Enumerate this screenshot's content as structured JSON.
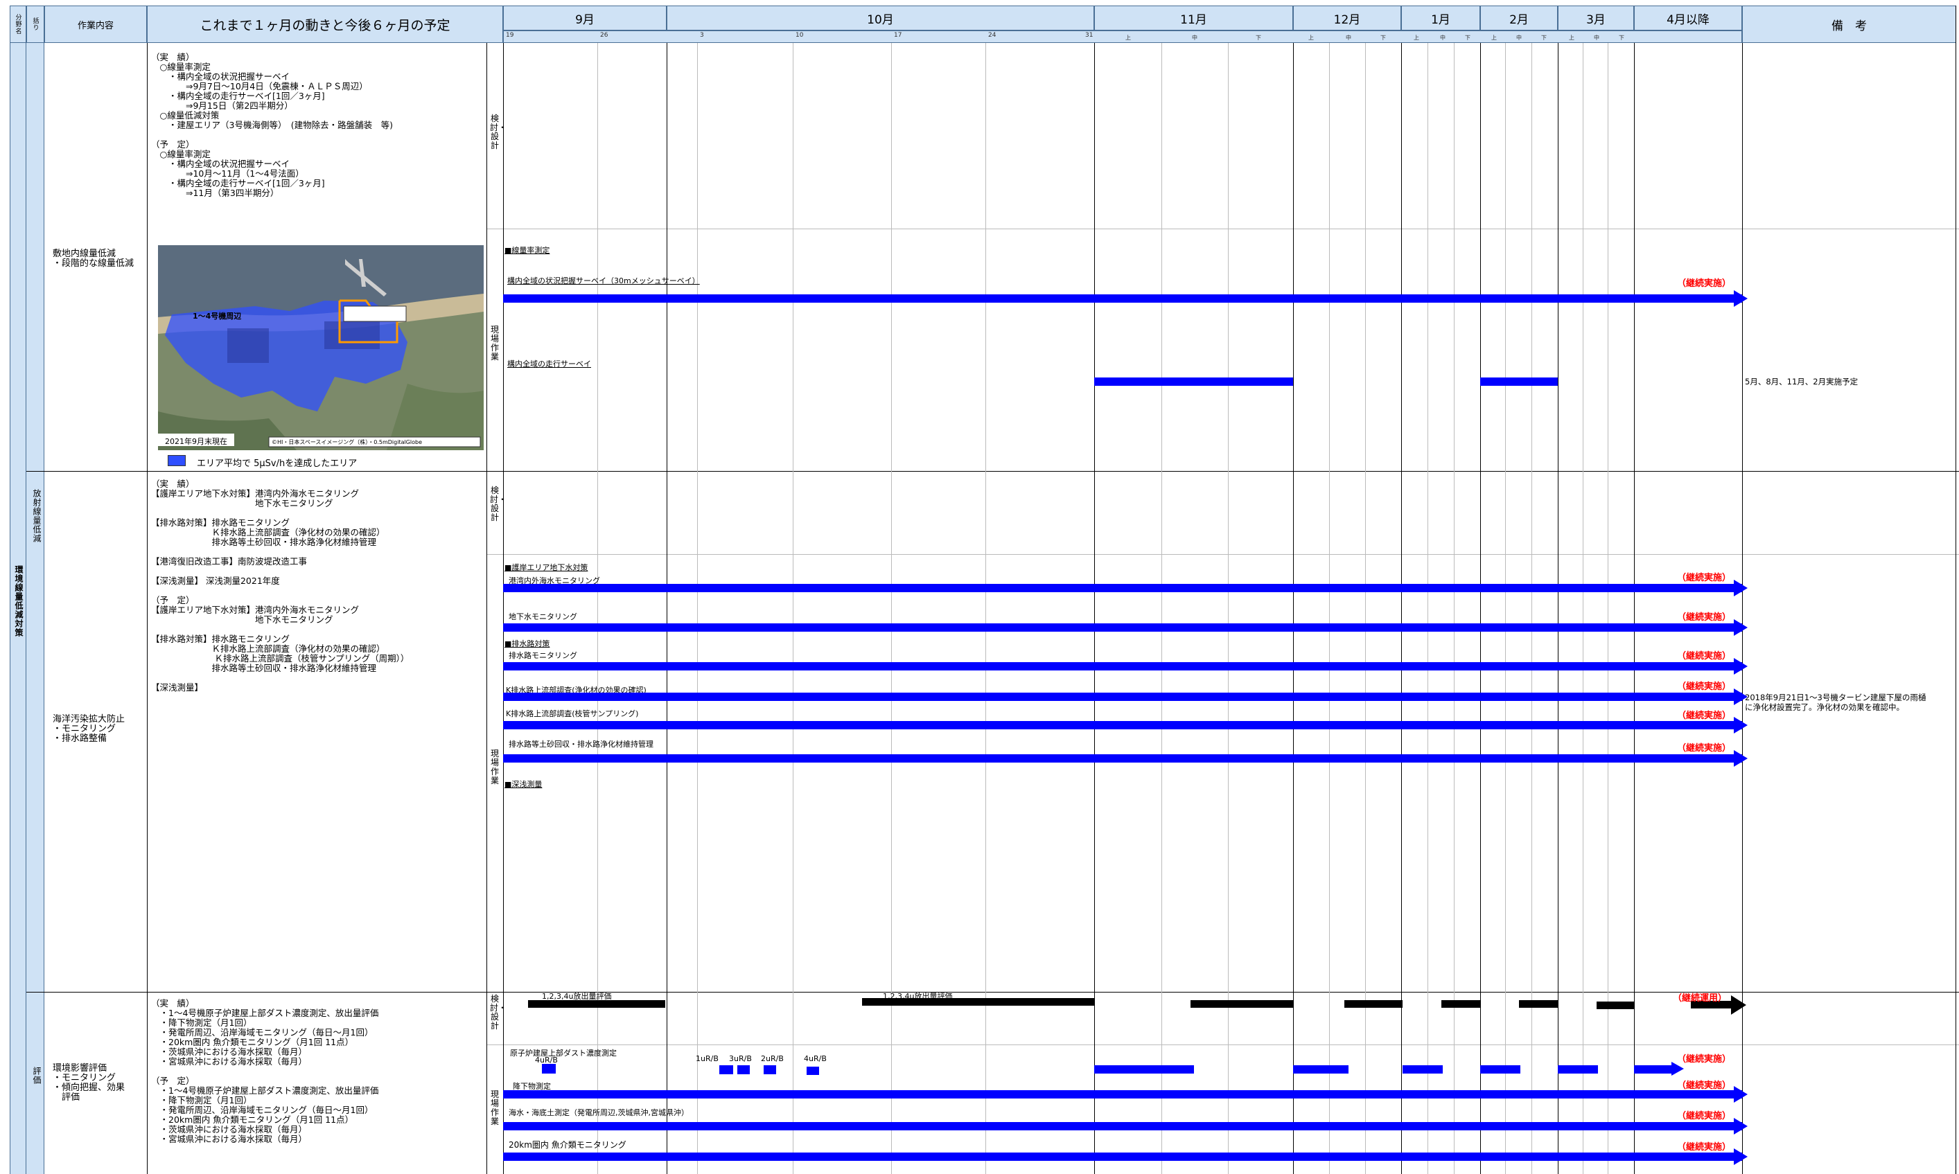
{
  "header": {
    "col1": "分野名",
    "col2": "括り",
    "col3": "作業内容",
    "col4": "これまで１ヶ月の動きと今後６ヶ月の予定",
    "months": [
      "9月",
      "10月",
      "11月",
      "12月",
      "1月",
      "2月",
      "3月",
      "4月以降"
    ],
    "remarks": "備　考",
    "days": [
      "19",
      "26",
      "3",
      "10",
      "17",
      "24",
      "31"
    ],
    "subs": [
      "上",
      "中",
      "下"
    ]
  },
  "left": {
    "category1": "環境線量低減対策",
    "category2": "放射線量低減"
  },
  "stages": {
    "study": "検討・設計",
    "field": "現場作業"
  },
  "section1": {
    "task": "敷地内線量低減\n・段階的な線量低減",
    "progress": "（実　績）\n　○線量率測定\n　　・構内全域の状況把握サーベイ\n　　　　⇒9月7日〜10月4日（免震棟・ＡＬＰＳ周辺）\n　　・構内全域の走行サーベイ[1回／3ヶ月]\n　　　　⇒9月15日（第2四半期分）\n　○線量低減対策\n　　・建屋エリア（3号機海側等）　(建物除去・路盤舗装　等)\n\n（予　定）\n　○線量率測定\n　　・構内全域の状況把握サーベイ\n　　　　⇒10月〜11月（1〜4号法面）\n　　・構内全域の走行サーベイ[1回／3ヶ月]\n　　　　⇒11月（第3四半期分）",
    "map_label": "1〜4号機周辺",
    "map_date": "2021年9月末現在",
    "map_credit": "©HI・日本スペースイメージング（株）・0.5mDigitalGlobe",
    "legend": "エリア平均で 5μSv/hを達成したエリア",
    "items": [
      "■線量率測定",
      "構内全域の状況把握サーベイ（30mメッシュサーベイ）",
      "構内全域の走行サーベイ"
    ],
    "cont": "（継続実施）",
    "remark": "5月、8月、11月、2月実施予定"
  },
  "section2": {
    "task": "海洋汚染拡大防止\n・モニタリング\n・排水路整備",
    "progress": "（実　績）\n【護岸エリア地下水対策】港湾内外海水モニタリング\n　　　　　　　　　　　　地下水モニタリング\n\n【排水路対策】排水路モニタリング\n　　　　　　　Ｋ排水路上流部調査（浄化材の効果の確認）\n　　　　　　　排水路等土砂回収・排水路浄化材維持管理\n\n【港湾復旧改造工事】南防波堤改造工事\n\n【深浅測量】 深浅測量2021年度\n\n（予　定）\n【護岸エリア地下水対策】港湾内外海水モニタリング\n　　　　　　　　　　　　地下水モニタリング\n\n【排水路対策】排水路モニタリング\n　　　　　　　Ｋ排水路上流部調査（浄化材の効果の確認）\n　　　　　　　 Ｋ排水路上流部調査（枝管サンプリング（周期））\n　　　　　　　排水路等土砂回収・排水路浄化材維持管理\n\n【深浅測量】",
    "items": [
      "■護岸エリア地下水対策",
      "港湾内外海水モニタリング",
      "地下水モニタリング",
      "■排水路対策",
      "排水路モニタリング",
      "K排水路上流部調査(浄化材の効果の確認)",
      "K排水路上流部調査(枝管サンプリング)",
      "排水路等土砂回収・排水路浄化材維持管理",
      "■深浅測量"
    ],
    "cont": "（継続実施）",
    "remark": "2018年9月21日1〜3号機タービン建屋下屋の雨樋\nに浄化材設置完了。浄化材の効果を確認中。"
  },
  "section3": {
    "category": "評価",
    "task": "環境影響評価\n・モニタリング\n・傾向把握、効果\n　評価",
    "progress": "（実　績）\n　・1〜4号機原子炉建屋上部ダスト濃度測定、放出量評価\n　・降下物測定（月1回）\n　・発電所周辺、沿岸海域モニタリング（毎日〜月1回）\n　・20km圏内 魚介類モニタリング（月1回 11点）\n　・茨城県沖における海水採取（毎月）\n　・宮城県沖における海水採取（毎月）\n\n（予　定）\n　・1〜4号機原子炉建屋上部ダスト濃度測定、放出量評価\n　・降下物測定（月1回）\n　・発電所周辺、沿岸海域モニタリング（毎日〜月1回）\n　・20km圏内 魚介類モニタリング（月1回 11点）\n　・茨城県沖における海水採取（毎月）\n　・宮城県沖における海水採取（毎月）",
    "eval1": "1,2,3,4u放出量評価",
    "eval2": "1,2,3,4u放出量評価",
    "cont_black": "（継続運用）",
    "items": [
      "原子炉建屋上部ダスト濃度測定",
      "降下物測定",
      "海水・海底土測定（発電所周辺,茨城県沖,宮城県沖）",
      "20km圏内 魚介類モニタリング"
    ],
    "unit_labels": [
      "4uR/B",
      "1uR/B",
      "3uR/B",
      "2uR/B",
      "4uR/B"
    ],
    "cont": "（継続実施）"
  }
}
